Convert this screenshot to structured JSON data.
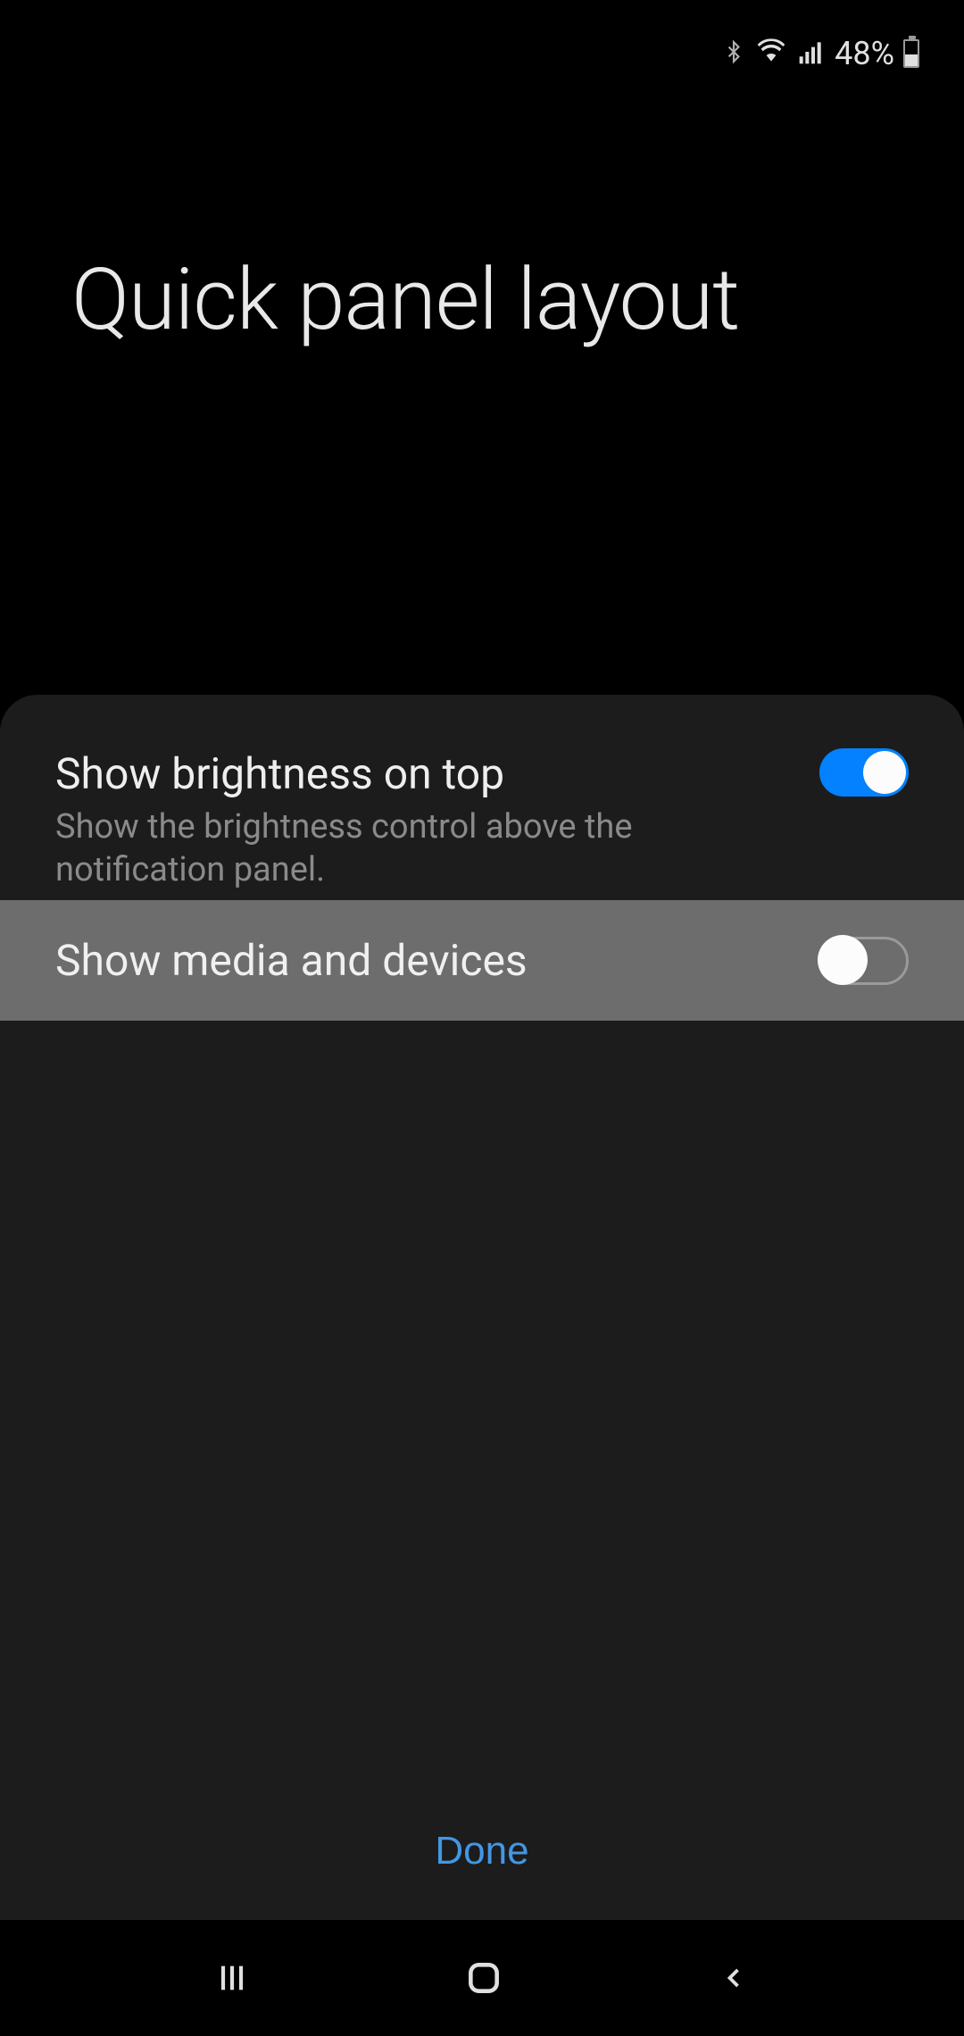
{
  "statusBar": {
    "batteryPercent": "48%"
  },
  "header": {
    "title": "Quick panel layout"
  },
  "settings": {
    "brightness": {
      "title": "Show brightness on top",
      "subtitle": "Show the brightness control above the notification panel.",
      "enabled": true
    },
    "media": {
      "title": "Show media and devices",
      "enabled": false
    }
  },
  "actions": {
    "done": "Done"
  }
}
